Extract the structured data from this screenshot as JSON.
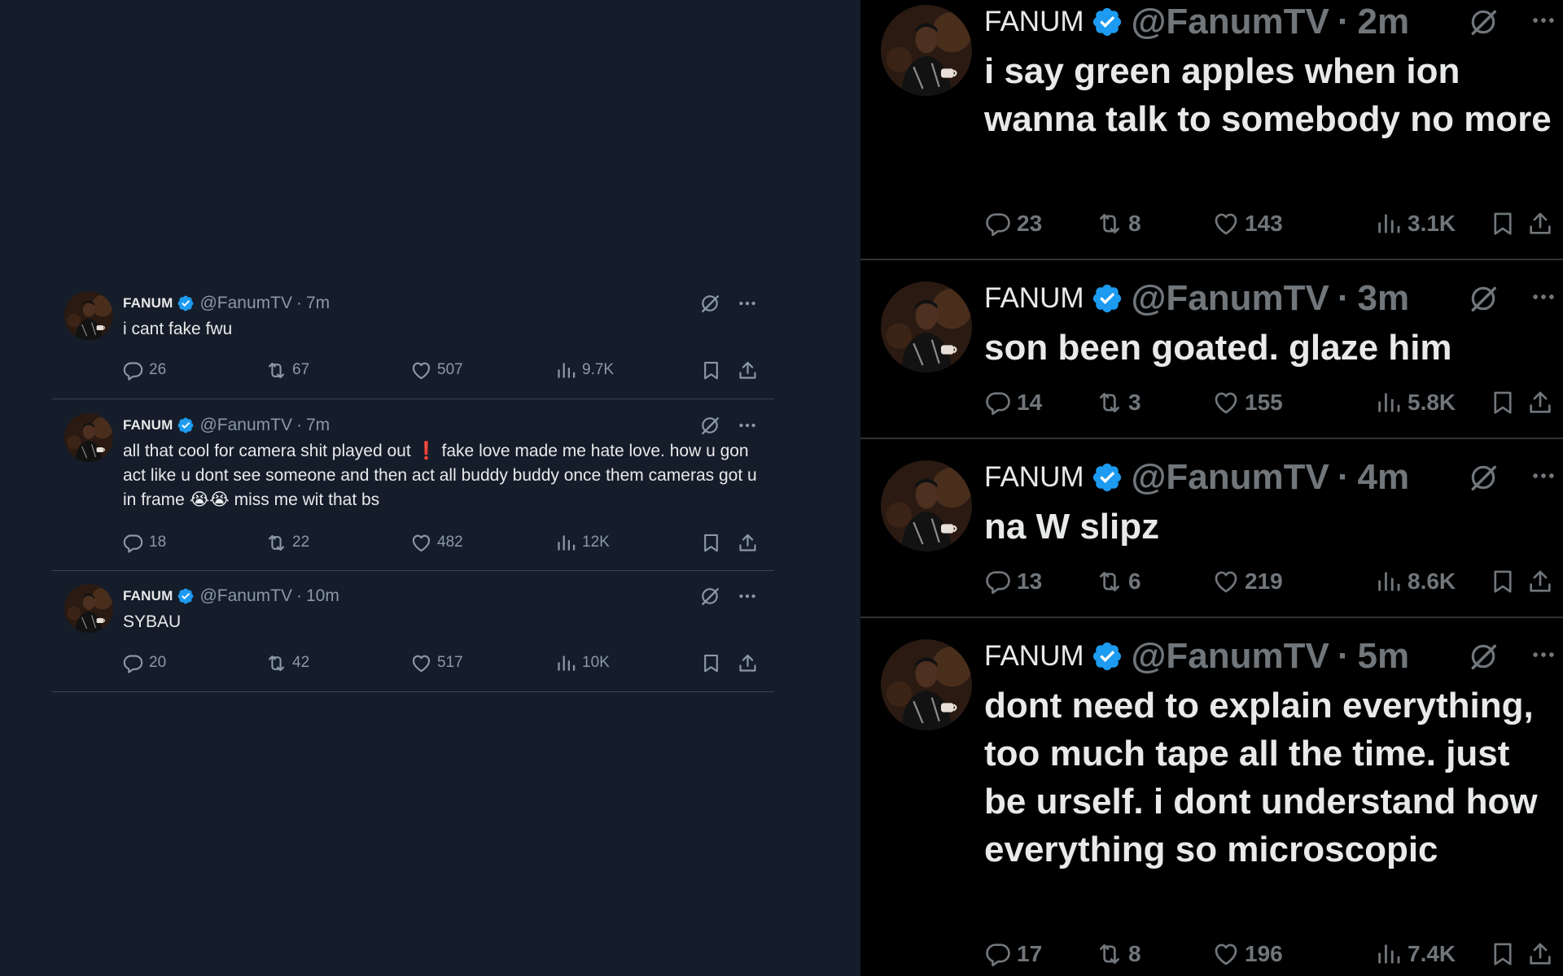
{
  "colors": {
    "left_bg": "#151d2a",
    "right_bg": "#000000",
    "verified_blue": "#1d9bf0",
    "muted_left": "#8b98a5",
    "muted_right": "#71767b",
    "text": "#e7e9ea",
    "alert_red": "#f4212e"
  },
  "left_tweets": [
    {
      "name": "FANUM",
      "handle": "@FanumTV",
      "dot": "·",
      "time": "7m",
      "text": "i cant fake fwu",
      "replies": "26",
      "reposts": "67",
      "likes": "507",
      "views": "9.7K"
    },
    {
      "name": "FANUM",
      "handle": "@FanumTV",
      "dot": "·",
      "time": "7m",
      "text_part1": "all that cool for camera shit played out",
      "alert_emoji": "❗",
      "text_part2": "fake love made me hate love. how u gon act like u dont see someone and then act all buddy buddy once them cameras got u in frame",
      "crying_emojis": "😭😭",
      "text_part3": "miss me wit that bs",
      "replies": "18",
      "reposts": "22",
      "likes": "482",
      "views": "12K"
    },
    {
      "name": "FANUM",
      "handle": "@FanumTV",
      "dot": "·",
      "time": "10m",
      "text": "SYBAU",
      "replies": "20",
      "reposts": "42",
      "likes": "517",
      "views": "10K"
    }
  ],
  "right_tweets": [
    {
      "name": "FANUM",
      "handle": "@FanumTV",
      "dot": "·",
      "time": "2m",
      "text": "i say green apples when ion wanna talk to somebody no more",
      "replies": "23",
      "reposts": "8",
      "likes": "143",
      "views": "3.1K"
    },
    {
      "name": "FANUM",
      "handle": "@FanumTV",
      "dot": "·",
      "time": "3m",
      "text": "son been goated. glaze him",
      "replies": "14",
      "reposts": "3",
      "likes": "155",
      "views": "5.8K"
    },
    {
      "name": "FANUM",
      "handle": "@FanumTV",
      "dot": "·",
      "time": "4m",
      "text": "na W slipz",
      "replies": "13",
      "reposts": "6",
      "likes": "219",
      "views": "8.6K"
    },
    {
      "name": "FANUM",
      "handle": "@FanumTV",
      "dot": "·",
      "time": "5m",
      "text": "dont need to explain everything, too much tape all the time. just be urself. i dont understand how everything so microscopic",
      "replies": "17",
      "reposts": "8",
      "likes": "196",
      "views": "7.4K"
    }
  ],
  "icons": [
    "avatar",
    "verified-badge-icon",
    "grok-icon",
    "more-icon",
    "reply-icon",
    "repost-icon",
    "like-icon",
    "views-icon",
    "bookmark-icon",
    "share-icon"
  ]
}
